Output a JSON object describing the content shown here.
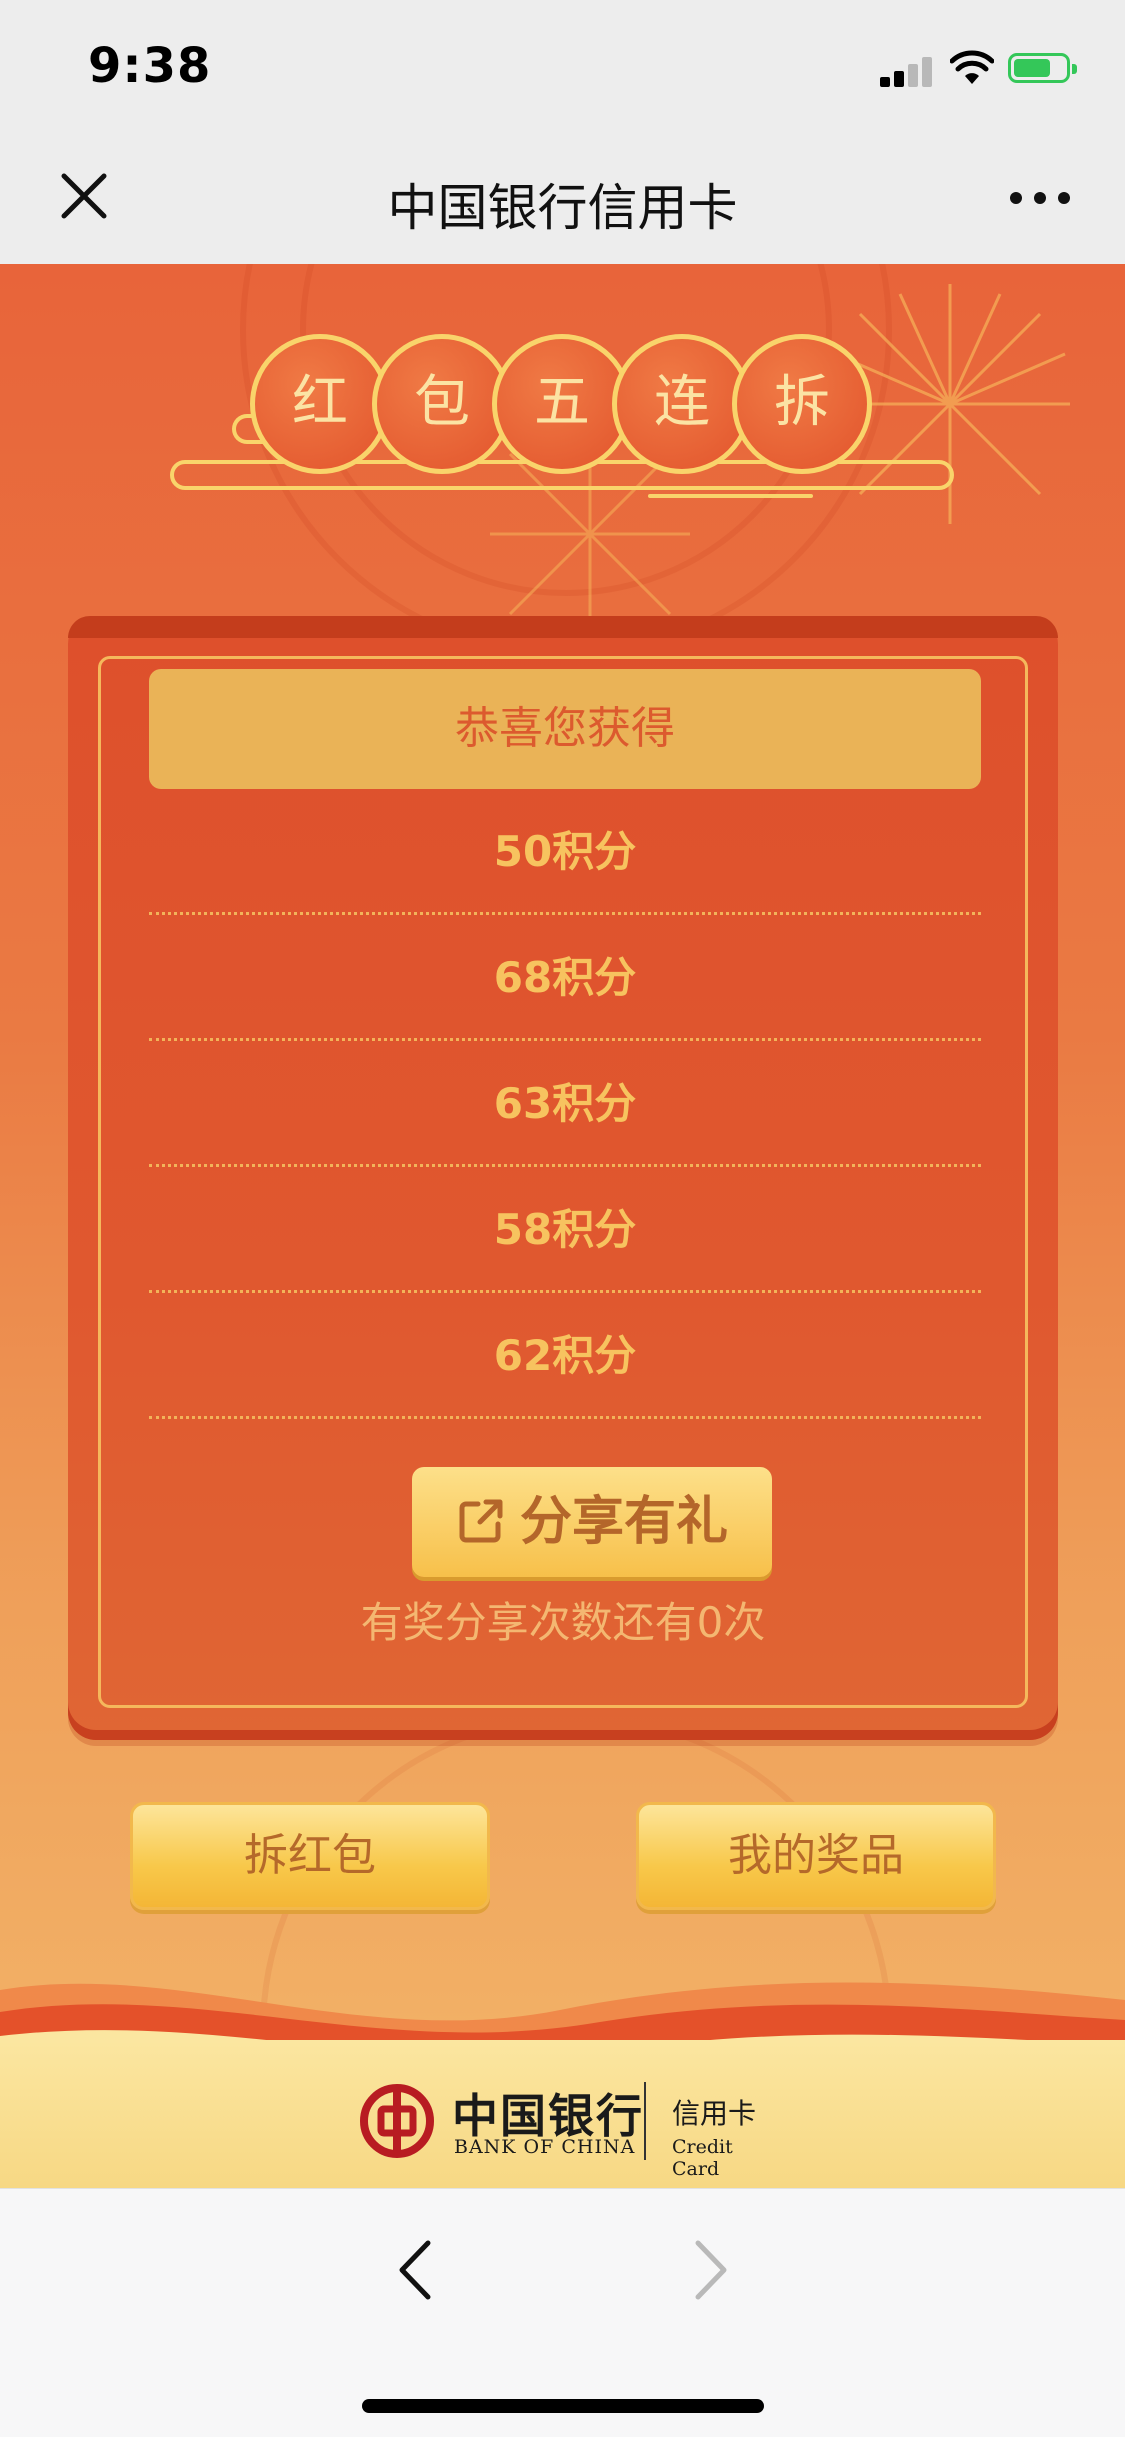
{
  "status_bar": {
    "time": "9:38"
  },
  "nav": {
    "title": "中国银行信用卡"
  },
  "banner": {
    "title_chars": [
      "红",
      "包",
      "五",
      "连",
      "拆"
    ]
  },
  "prize_card": {
    "header": "恭喜您获得",
    "prizes": [
      "50积分",
      "68积分",
      "63积分",
      "58积分",
      "62积分"
    ],
    "share_button": "分享有礼",
    "share_note": "有奖分享次数还有0次"
  },
  "actions": {
    "open_label": "拆红包",
    "my_prizes_label": "我的奖品"
  },
  "footer": {
    "logo_cn": "中国银行",
    "logo_en": "BANK OF CHINA",
    "sub_cn": "信用卡",
    "sub_en": "Credit Card"
  },
  "colors": {
    "page_orange": "#e8643a",
    "card_red": "#de502c",
    "gold": "#f9d46b",
    "button_yellow": "#f8c84a"
  },
  "icons": [
    "close-icon",
    "more-icon",
    "share-icon",
    "back-icon",
    "forward-icon"
  ]
}
